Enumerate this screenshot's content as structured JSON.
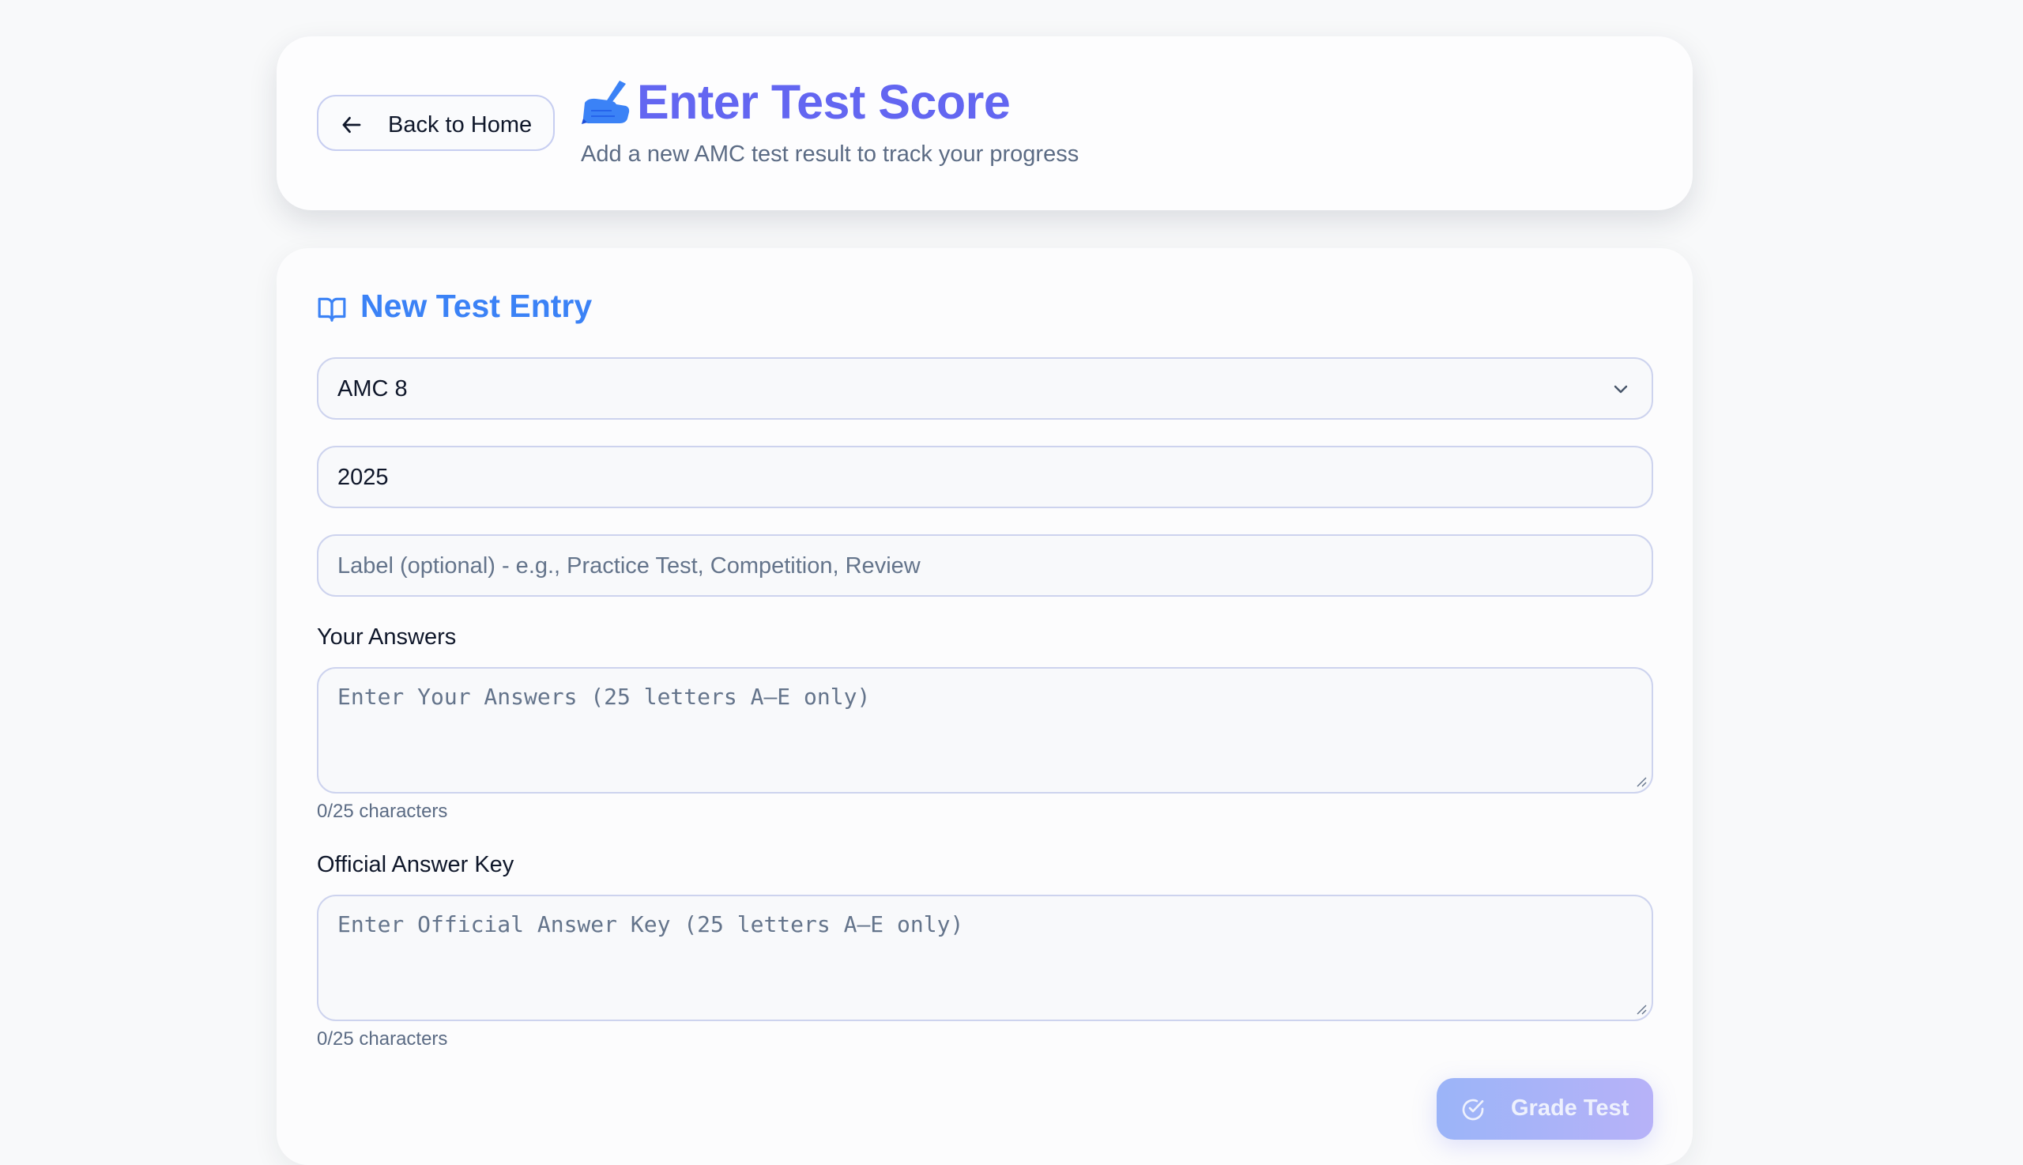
{
  "header": {
    "back_label": "Back to Home",
    "title": "Enter Test Score",
    "subtitle": "Add a new AMC test result to track your progress",
    "title_icon": "writing-hand-icon"
  },
  "form": {
    "section_title": "New Test Entry",
    "section_icon": "book-open-icon",
    "contest_select": {
      "selected": "AMC 8"
    },
    "year_input": {
      "value": "2025"
    },
    "label_input": {
      "placeholder": "Label (optional) - e.g., Practice Test, Competition, Review"
    },
    "your_answers": {
      "label": "Your Answers",
      "placeholder": "Enter Your Answers (25 letters A–E only)",
      "counter": "0/25 characters"
    },
    "answer_key": {
      "label": "Official Answer Key",
      "placeholder": "Enter Official Answer Key (25 letters A–E only)",
      "counter": "0/25 characters"
    },
    "grade_button": {
      "label": "Grade Test",
      "icon": "check-circle-icon"
    }
  },
  "colors": {
    "title": "#6366f1",
    "section_title": "#3b82f6",
    "grade_button_start": "#9bb4f8",
    "grade_button_end": "#b7b2f8"
  }
}
